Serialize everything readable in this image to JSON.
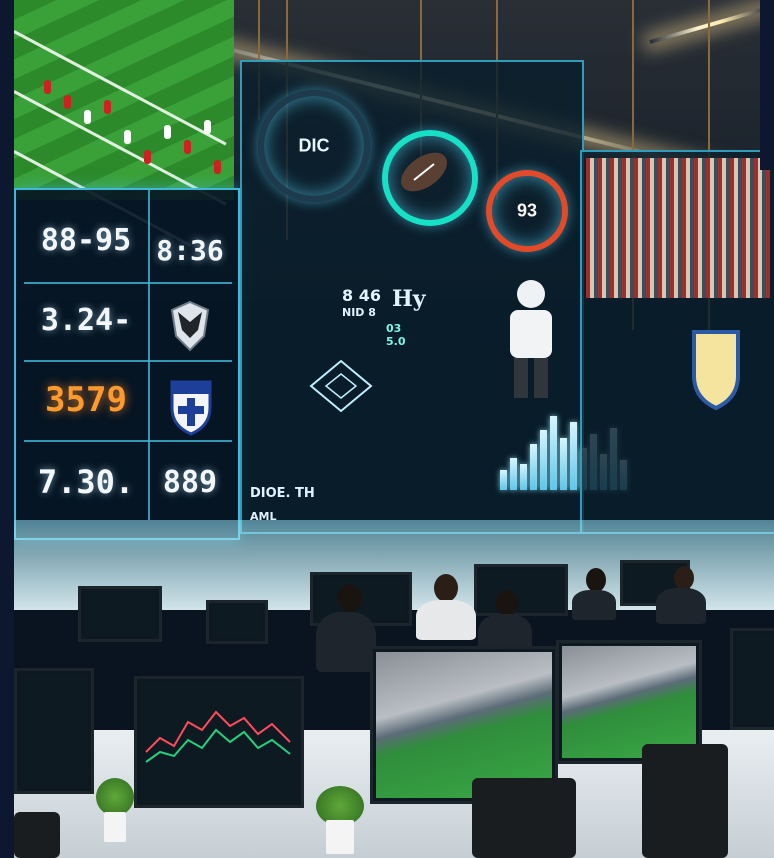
{
  "scoreboard": {
    "cells": [
      "88-95",
      "8:36",
      "3.24-",
      "3579",
      "7.30.",
      "889"
    ]
  },
  "center_display": {
    "dial_1_label": "DIC",
    "dial_3_label": "93",
    "text_1": "8 46",
    "text_2": "NID 8",
    "text_3": "Hy",
    "text_4": "03\n5.0",
    "caption_1": "DIOE. TH",
    "caption_2": "AML"
  },
  "colors": {
    "accent": "#3fb8d9",
    "orange_value": "#ff9a2e",
    "field_green": "#2f8d3b"
  }
}
